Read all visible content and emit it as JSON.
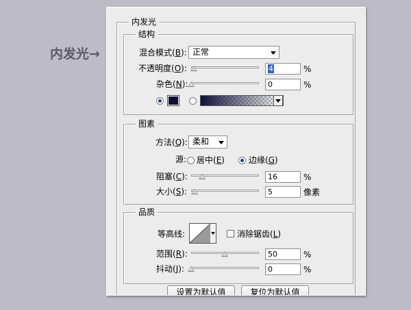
{
  "annotation": {
    "text": "内发光→"
  },
  "panel": {
    "title": "内发光"
  },
  "structure": {
    "title": "结构",
    "blend_mode": {
      "label": "混合模式",
      "mnemonic": "B",
      "value": "正常"
    },
    "opacity": {
      "label": "不透明度",
      "mnemonic": "O",
      "value": "4",
      "unit": "%",
      "slider_fraction": 0.04
    },
    "noise": {
      "label": "杂色",
      "mnemonic": "N",
      "value": "0",
      "unit": "%",
      "slider_fraction": 0.0
    },
    "fill": {
      "solid_selected": true,
      "swatch_color": "#0f0d33"
    }
  },
  "elements": {
    "title": "图素",
    "technique": {
      "label": "方法",
      "mnemonic": "Q",
      "value": "柔和"
    },
    "source": {
      "label": "源:",
      "center": {
        "label": "居中",
        "mnemonic": "E",
        "selected": false
      },
      "edge": {
        "label": "边缘",
        "mnemonic": "G",
        "selected": true
      }
    },
    "choke": {
      "label": "阻塞",
      "mnemonic": "C",
      "value": "16",
      "unit": "%",
      "slider_fraction": 0.16
    },
    "size": {
      "label": "大小",
      "mnemonic": "S",
      "value": "5",
      "unit": "像素",
      "slider_fraction": 0.02
    }
  },
  "quality": {
    "title": "品质",
    "contour": {
      "label": "等高线:"
    },
    "anti_alias": {
      "label": "消除锯齿",
      "mnemonic": "L",
      "checked": false
    },
    "range": {
      "label": "范围",
      "mnemonic": "R",
      "value": "50",
      "unit": "%",
      "slider_fraction": 0.5
    },
    "jitter": {
      "label": "抖动",
      "mnemonic": "J",
      "value": "0",
      "unit": "%",
      "slider_fraction": 0.0
    }
  },
  "buttons": {
    "make_default": "设置为默认值",
    "reset_default": "复位为默认值"
  }
}
